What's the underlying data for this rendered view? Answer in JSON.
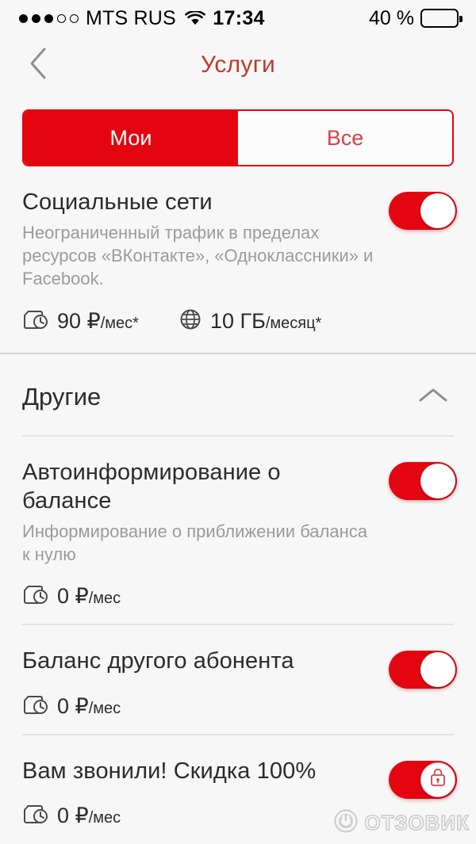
{
  "status_bar": {
    "signal_dots_filled": 3,
    "signal_dots_total": 5,
    "carrier": "MTS RUS",
    "wifi_icon": "wifi-icon",
    "time": "17:34",
    "battery_percent": "40 %",
    "battery_level": 40,
    "battery_color": "#f6cf23"
  },
  "nav": {
    "back_icon": "chevron-left-icon",
    "title": "Услуги"
  },
  "segmented_control": {
    "selected": "Мои",
    "options": [
      {
        "label": "Мои",
        "active": true
      },
      {
        "label": "Все",
        "active": false
      }
    ]
  },
  "theme": {
    "accent_red": "#e30611",
    "title_red": "#c0392b",
    "text_dark": "#2b2b2b",
    "text_muted": "#9b9b9b",
    "page_bg": "#f7f7f7"
  },
  "my_services": [
    {
      "title": "Социальные сети",
      "description": "Неограниченный трафик в пределах ресурсов «ВКонтакте», «Одноклассники» и Facebook.",
      "meta": [
        {
          "icon": "wallet-clock-icon",
          "value": "90 ₽",
          "unit": "/мес*"
        },
        {
          "icon": "globe-icon",
          "value": "10 ГБ",
          "unit": "/месяц*"
        }
      ],
      "toggle": {
        "state": "on",
        "locked": false
      }
    }
  ],
  "other_section": {
    "title": "Другие",
    "collapse_icon": "chevron-up-icon",
    "expanded": true,
    "items": [
      {
        "title": "Автоинформирование о балансе",
        "description": "Информирование о приближении баланса к нулю",
        "meta": [
          {
            "icon": "wallet-clock-icon",
            "value": "0 ₽",
            "unit": "/мес"
          }
        ],
        "toggle": {
          "state": "on",
          "locked": false
        }
      },
      {
        "title": "Баланс другого абонента",
        "description": "",
        "meta": [
          {
            "icon": "wallet-clock-icon",
            "value": "0 ₽",
            "unit": "/мес"
          }
        ],
        "toggle": {
          "state": "on",
          "locked": false
        }
      },
      {
        "title": "Вам звонили! Скидка 100%",
        "description": "",
        "meta": [
          {
            "icon": "wallet-clock-icon",
            "value": "0 ₽",
            "unit": "/мес"
          }
        ],
        "toggle": {
          "state": "on",
          "locked": true,
          "lock_icon": "lock-icon"
        }
      }
    ]
  },
  "watermark": {
    "logo_icon": "power-circle-icon",
    "text": "ОТЗОВИК"
  }
}
